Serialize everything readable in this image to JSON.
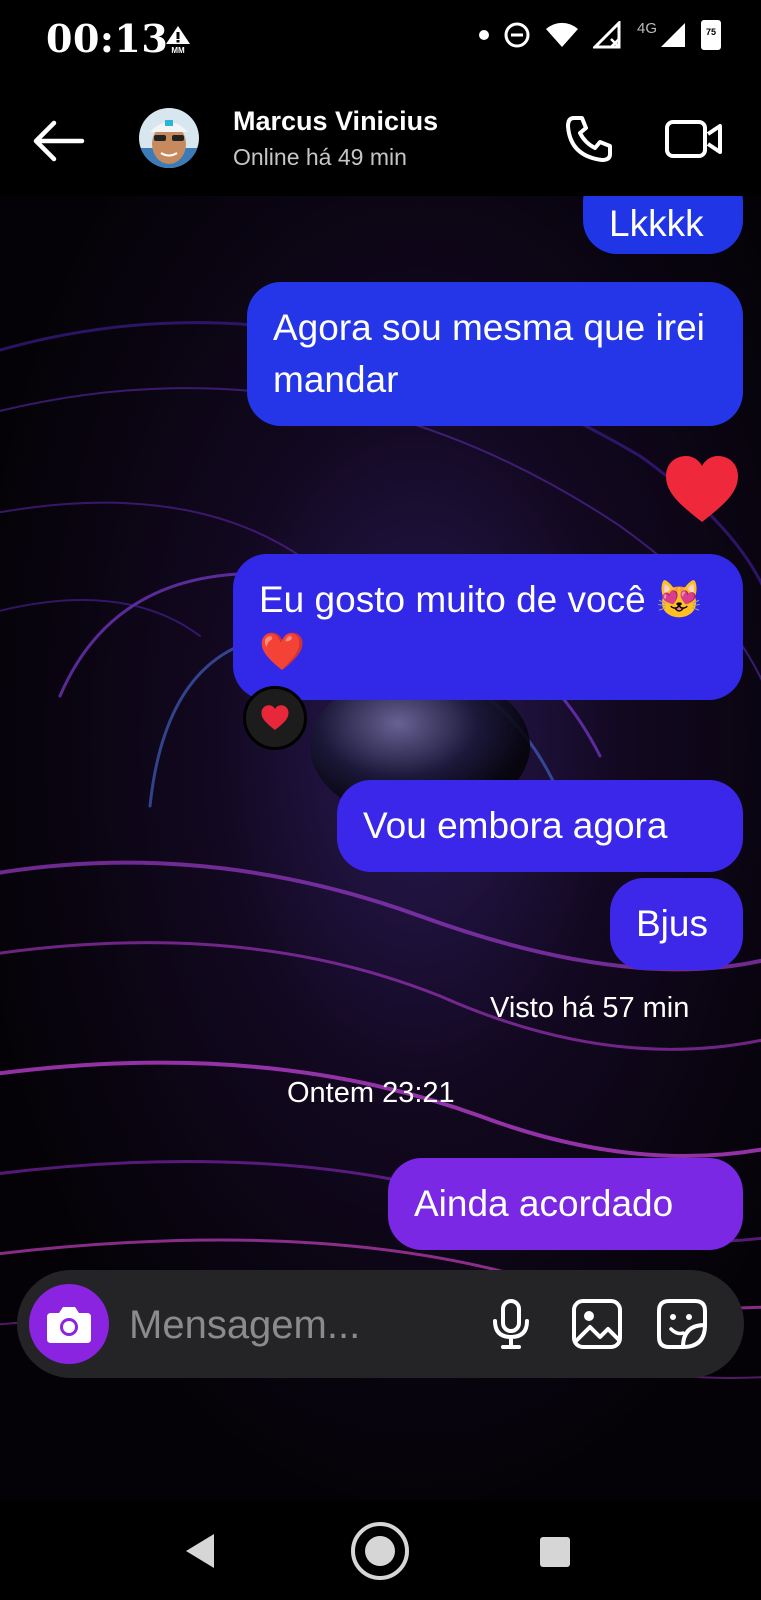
{
  "status_bar": {
    "time": "00:13",
    "network": "4G",
    "battery": "75",
    "icons": [
      "alert-icon",
      "dot-icon",
      "do-not-disturb-icon",
      "wifi-icon",
      "signal-no-data-icon",
      "signal-4g-icon",
      "battery-icon"
    ]
  },
  "header": {
    "contact_name": "Marcus Vinicius",
    "contact_status": "Online há 49 min",
    "icons": [
      "back-arrow-icon",
      "avatar",
      "phone-icon",
      "video-camera-icon"
    ]
  },
  "messages": [
    {
      "text": "Lkkkk",
      "sent": true,
      "color": "#1f35e6"
    },
    {
      "text": "Agora sou mesma que irei mandar",
      "sent": true,
      "color": "#2436e8"
    },
    {
      "text": "❤️",
      "sent": true,
      "emoji_only": true
    },
    {
      "text": "Eu gosto muito de você 😻❤️",
      "sent": true,
      "color": "#3128e8",
      "reaction": "❤️"
    },
    {
      "text": "Vou embora agora",
      "sent": true,
      "color": "#3b27e9"
    },
    {
      "text": "Bjus",
      "sent": true,
      "color": "#3d28ea"
    },
    {
      "text": "Ainda acordado",
      "sent": true,
      "color": "#7a28e3"
    }
  ],
  "seen_label": "Visto há 57 min",
  "timestamp_label": "Ontem 23:21",
  "composer": {
    "placeholder": "Mensagem...",
    "icons": [
      "camera-icon",
      "microphone-icon",
      "image-icon",
      "sticker-icon"
    ],
    "camera_color": "#8a24e0"
  },
  "nav_bar": {
    "icons": [
      "back-triangle-icon",
      "home-circle-icon",
      "recents-square-icon"
    ]
  }
}
